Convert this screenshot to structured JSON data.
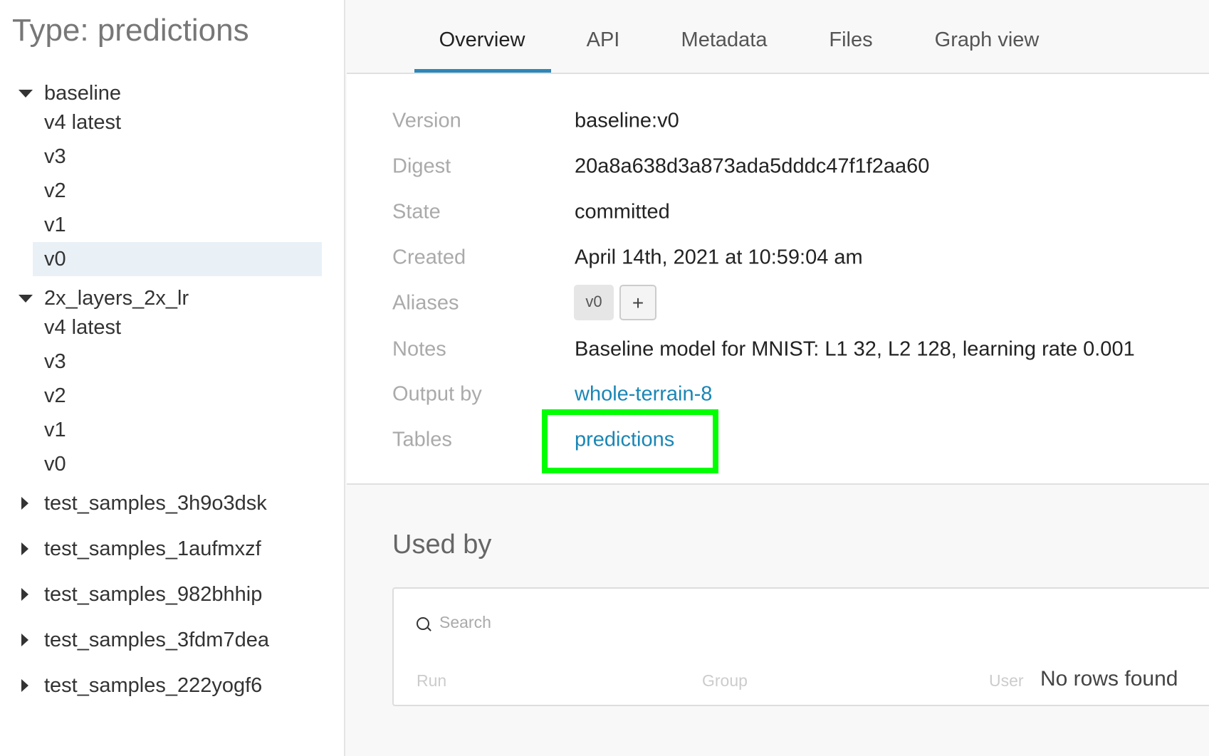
{
  "sidebar": {
    "title": "Type: predictions",
    "groups": [
      {
        "name": "baseline",
        "expanded": true,
        "versions": [
          "v4 latest",
          "v3",
          "v2",
          "v1",
          "v0"
        ],
        "selected": "v0"
      },
      {
        "name": "2x_layers_2x_lr",
        "expanded": true,
        "versions": [
          "v4 latest",
          "v3",
          "v2",
          "v1",
          "v0"
        ]
      },
      {
        "name": "test_samples_3h9o3dsk",
        "expanded": false
      },
      {
        "name": "test_samples_1aufmxzf",
        "expanded": false
      },
      {
        "name": "test_samples_982bhhip",
        "expanded": false
      },
      {
        "name": "test_samples_3fdm7dea",
        "expanded": false
      },
      {
        "name": "test_samples_222yogf6",
        "expanded": false
      }
    ]
  },
  "tabs": [
    {
      "label": "Overview",
      "active": true
    },
    {
      "label": "API"
    },
    {
      "label": "Metadata"
    },
    {
      "label": "Files"
    },
    {
      "label": "Graph view"
    }
  ],
  "overview": {
    "labels": {
      "version": "Version",
      "digest": "Digest",
      "state": "State",
      "created": "Created",
      "aliases": "Aliases",
      "notes": "Notes",
      "output_by": "Output by",
      "tables": "Tables"
    },
    "version": "baseline:v0",
    "digest": "20a8a638d3a873ada5dddc47f1f2aa60",
    "state": "committed",
    "created": "April 14th, 2021 at 10:59:04 am",
    "aliases": [
      "v0"
    ],
    "add_alias": "+",
    "notes": "Baseline model for MNIST: L1 32, L2 128, learning rate 0.001",
    "output_by": "whole-terrain-8",
    "tables": "predictions"
  },
  "highlight_color": "#00ff00",
  "used_by": {
    "title": "Used by",
    "search_placeholder": "Search",
    "columns": [
      "Run",
      "Group",
      "User"
    ],
    "empty": "No rows found"
  }
}
